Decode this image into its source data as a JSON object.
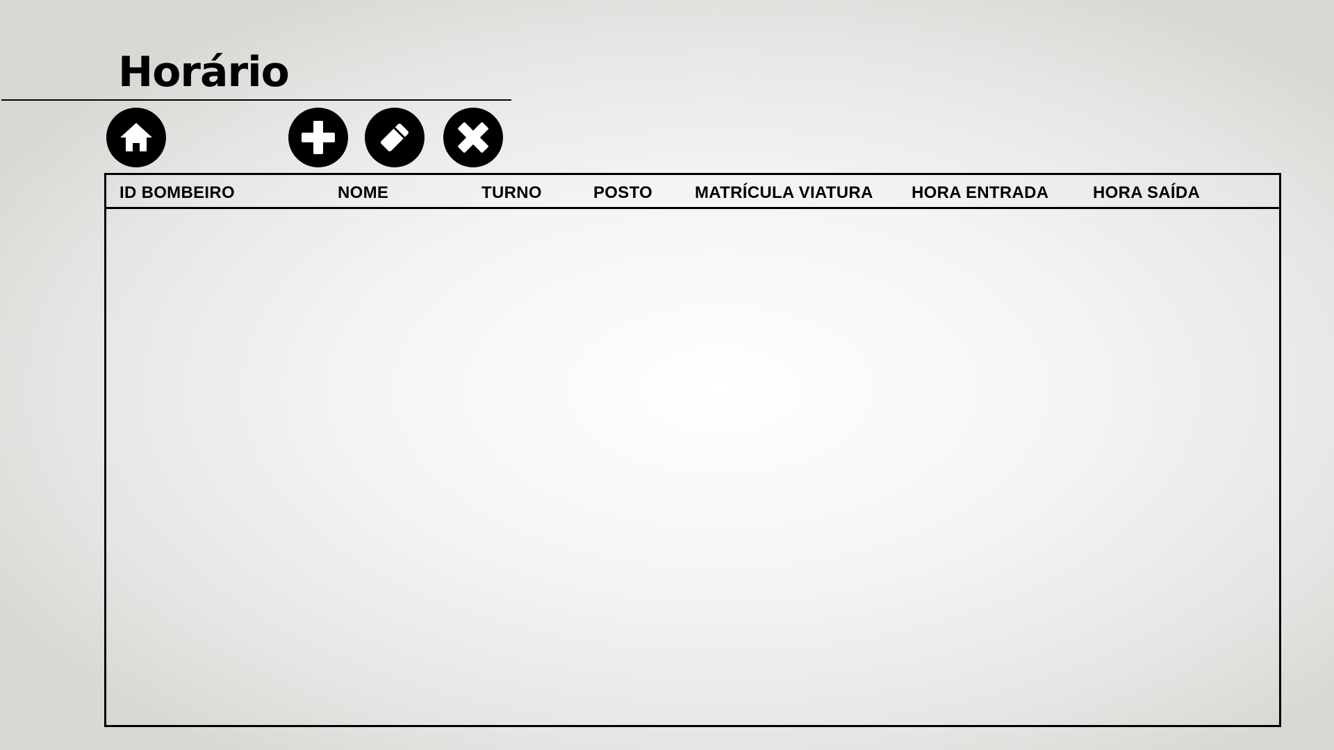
{
  "page": {
    "title": "Horário"
  },
  "toolbar": {
    "buttons": [
      {
        "name": "home",
        "icon": "home-icon"
      },
      {
        "name": "add",
        "icon": "plus-icon"
      },
      {
        "name": "edit",
        "icon": "eraser-icon"
      },
      {
        "name": "delete",
        "icon": "close-icon"
      }
    ]
  },
  "table": {
    "columns": [
      "ID BOMBEIRO",
      "NOME",
      "TURNO",
      "POSTO",
      "MATRÍCULA VIATURA",
      "HORA ENTRADA",
      "HORA SAÍDA"
    ],
    "rows": []
  },
  "colors": {
    "foreground": "#000000",
    "background": "#f4f4f2"
  }
}
